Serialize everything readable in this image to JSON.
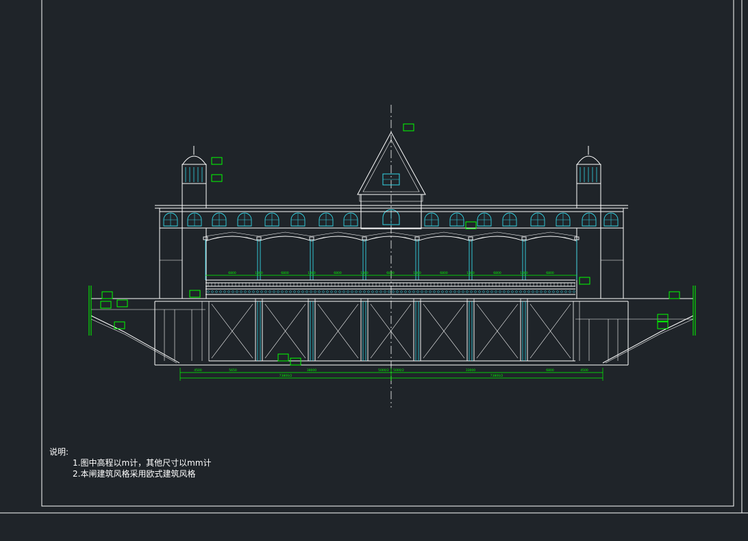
{
  "colors": {
    "background": "#1f2429",
    "linework": "#ffffff",
    "cyan": "#33d6e6",
    "green": "#00ff00"
  },
  "dimensions": {
    "bay_spans": [
      "6800",
      "6800",
      "6800",
      "6800",
      "6800",
      "6800",
      "6800"
    ],
    "pier_widths": [
      "1400",
      "1400",
      "1400",
      "1400",
      "1400",
      "1400"
    ],
    "bottom_row": [
      "4500",
      "5650",
      "38000",
      "5000/2",
      "5000/2",
      "33000",
      "6800",
      "4500"
    ],
    "totals": [
      "73800/2",
      "73800/2"
    ]
  },
  "notes": {
    "heading": "说明:",
    "items": [
      "1.图中高程以m计，其他尺寸以mm计",
      "2.本闸建筑风格采用欧式建筑风格"
    ]
  }
}
